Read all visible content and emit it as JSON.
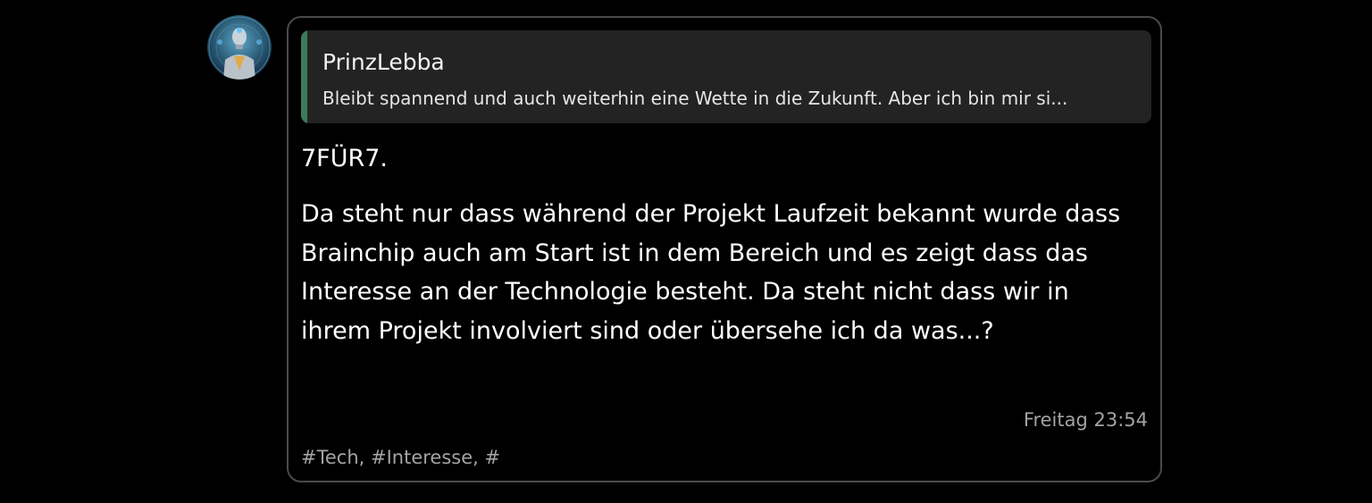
{
  "post": {
    "quote": {
      "author": "PrinzLebba",
      "text": "Bleibt spannend und auch weiterhin eine Wette in die Zukunft. Aber ich bin mir si..."
    },
    "title": "7FÜR7.",
    "body": "Da steht nur dass während der Projekt Laufzeit bekannt wurde dass Brainchip auch am Start ist in dem Bereich und es zeigt dass das Interesse an der Technologie besteht. Da steht nicht dass wir in ihrem Projekt involviert sind oder übersehe ich da was...?",
    "timestamp": "Freitag 23:54",
    "tags": "#Tech, #Interesse, #"
  },
  "colors": {
    "background": "#000000",
    "card_border": "#4a4a4a",
    "quote_background": "#232323",
    "quote_accent": "#3d7a5c",
    "meta_text": "#a3a3a3"
  }
}
